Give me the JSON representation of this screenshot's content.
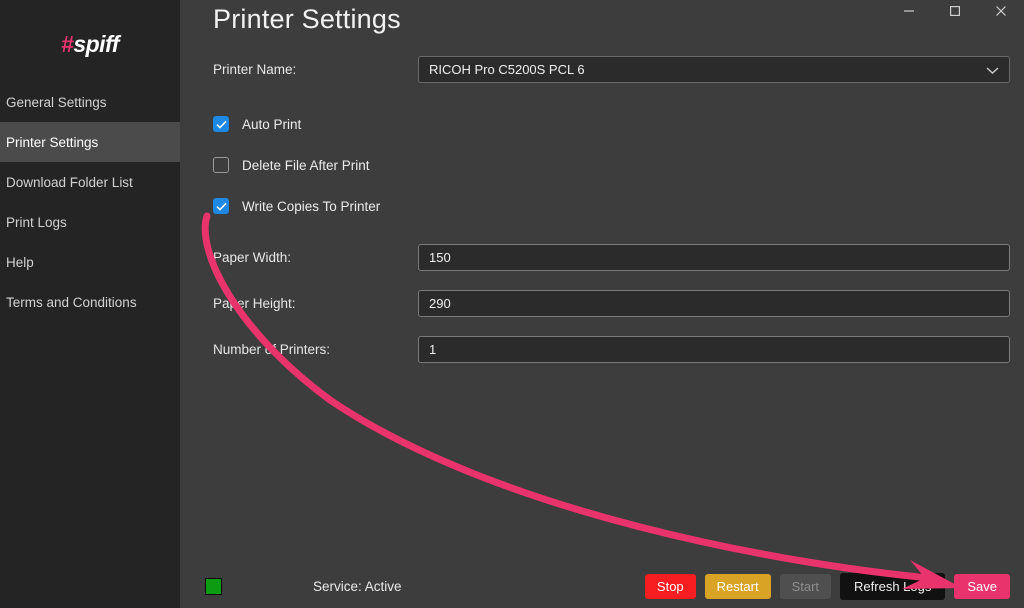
{
  "window": {
    "controls": [
      {
        "name": "minimize",
        "glyph": "minimize-icon"
      },
      {
        "name": "maximize",
        "glyph": "maximize-icon"
      },
      {
        "name": "close",
        "glyph": "close-icon"
      }
    ]
  },
  "sidebar": {
    "logo": {
      "hash": "#",
      "word": "spiff",
      "accent": "#e8336d"
    },
    "items": [
      {
        "label": "General Settings",
        "active": false
      },
      {
        "label": "Printer Settings",
        "active": true
      },
      {
        "label": "Download Folder List",
        "active": false
      },
      {
        "label": "Print Logs",
        "active": false
      },
      {
        "label": "Help",
        "active": false
      },
      {
        "label": "Terms and Conditions",
        "active": false
      }
    ]
  },
  "main": {
    "title": "Printer Settings",
    "fields": {
      "printer_name": {
        "label": "Printer Name:",
        "value": "RICOH Pro C5200S PCL 6"
      },
      "paper_width": {
        "label": "Paper Width:",
        "value": "150"
      },
      "paper_height": {
        "label": "Paper Height:",
        "value": "290"
      },
      "number_of_printers": {
        "label": "Number of Printers:",
        "value": "1"
      }
    },
    "checkboxes": [
      {
        "label": "Auto Print",
        "checked": true
      },
      {
        "label": "Delete File After Print",
        "checked": false
      },
      {
        "label": "Write Copies To Printer",
        "checked": true
      }
    ]
  },
  "bottom": {
    "status_color": "#0d9b13",
    "status_text": "Service: Active",
    "buttons": {
      "stop": "Stop",
      "restart": "Restart",
      "start": "Start",
      "refresh": "Refresh Logs",
      "save": "Save"
    }
  },
  "annotation": {
    "color": "#e8336d",
    "target": "Save"
  }
}
